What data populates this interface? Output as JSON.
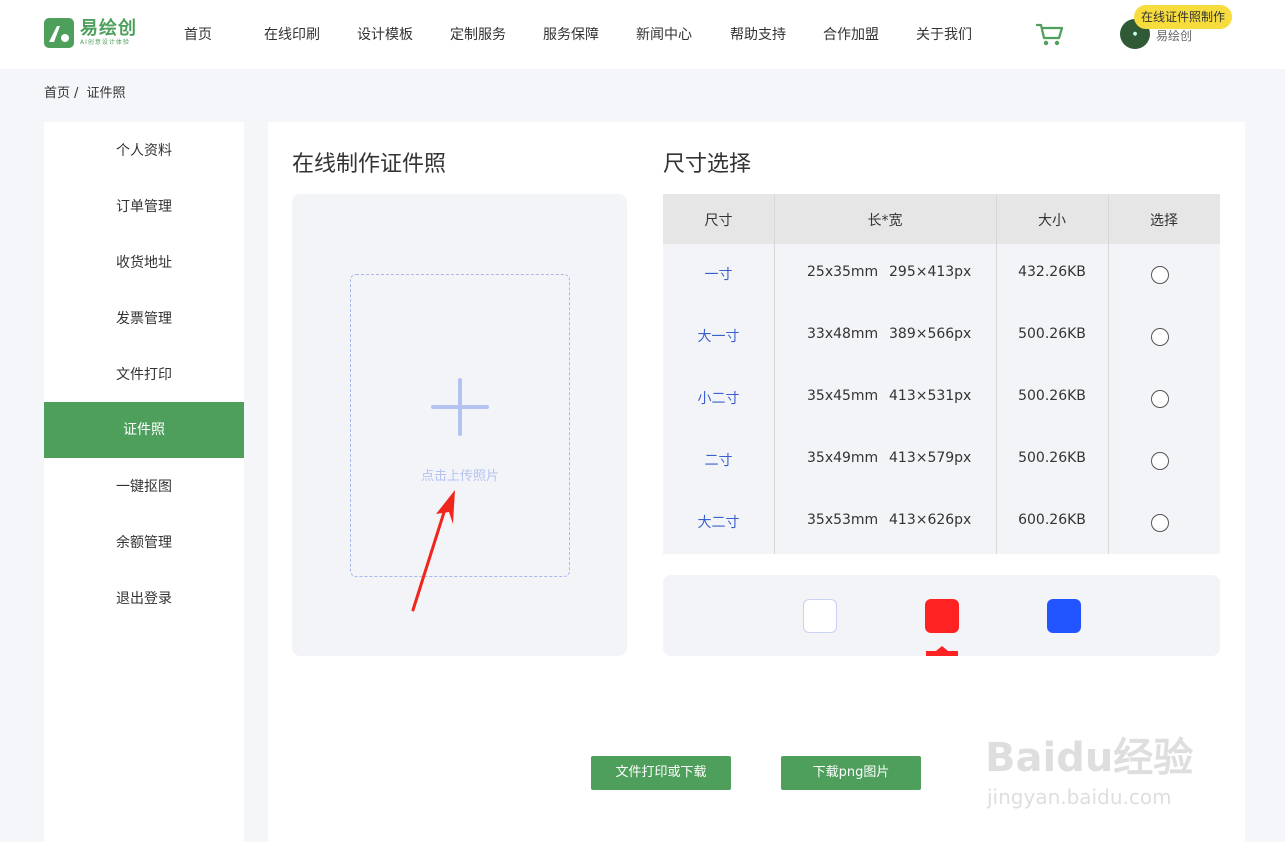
{
  "header": {
    "logo_name": "易绘创",
    "logo_sub": "AI创意设计体验",
    "nav": [
      "首页",
      "在线印刷",
      "设计模板",
      "定制服务",
      "服务保障",
      "新闻中心",
      "帮助支持",
      "合作加盟",
      "关于我们"
    ],
    "username": "易绘创",
    "badge": "在线证件照制作"
  },
  "breadcrumb": {
    "home": "首页",
    "separator": "/",
    "current": "证件照"
  },
  "sidebar": {
    "items": [
      "个人资料",
      "订单管理",
      "收货地址",
      "发票管理",
      "文件打印",
      "证件照",
      "一键抠图",
      "余额管理",
      "退出登录"
    ],
    "active_index": 5
  },
  "main": {
    "title_left": "在线制作证件照",
    "title_right": "尺寸选择",
    "upload_text": "点击上传照片",
    "table": {
      "headers": [
        "尺寸",
        "长*宽",
        "大小",
        "选择"
      ],
      "rows": [
        {
          "name": "一寸",
          "mm": "25x35mm",
          "px": "295×413px",
          "size": "432.26KB"
        },
        {
          "name": "大一寸",
          "mm": "33x48mm",
          "px": "389×566px",
          "size": "500.26KB"
        },
        {
          "name": "小二寸",
          "mm": "35x45mm",
          "px": "413×531px",
          "size": "500.26KB"
        },
        {
          "name": "二寸",
          "mm": "35x49mm",
          "px": "413×579px",
          "size": "500.26KB"
        },
        {
          "name": "大二寸",
          "mm": "35x53mm",
          "px": "413×626px",
          "size": "600.26KB"
        }
      ]
    },
    "colors": [
      "#ffffff",
      "#ff2222",
      "#2255ff"
    ],
    "selected_color_index": 1,
    "buttons": {
      "print": "文件打印或下载",
      "download": "下载png图片"
    }
  },
  "theme": {
    "accent": "#4e9f5c",
    "link": "#3a5fcf"
  },
  "watermark": {
    "brand": "Baidu经验",
    "url": "jingyan.baidu.com"
  }
}
